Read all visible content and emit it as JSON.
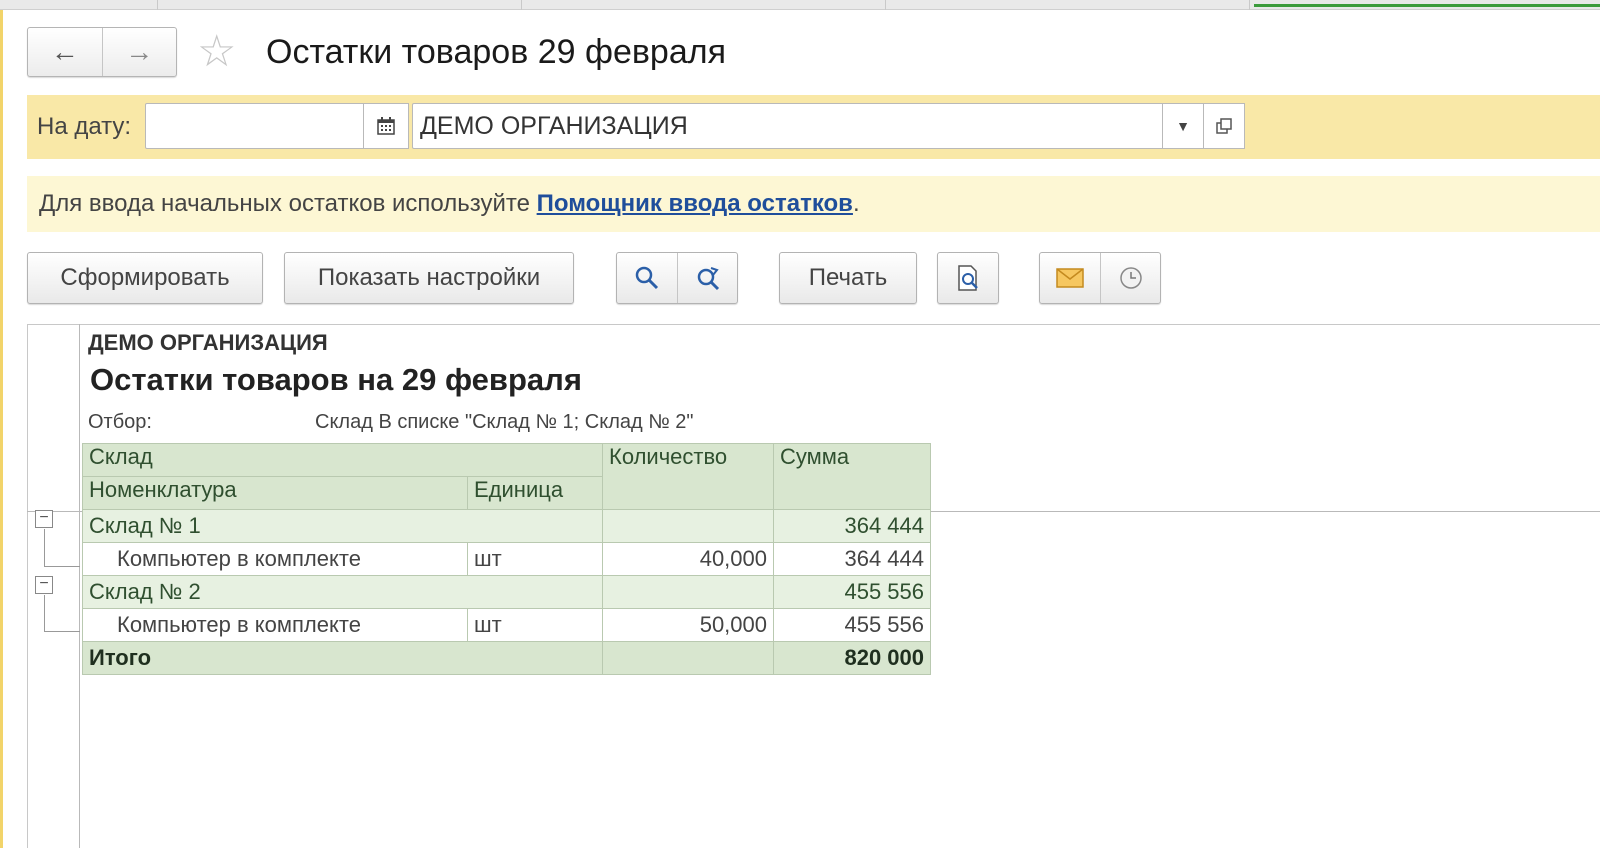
{
  "window": {
    "title": "Остатки товаров 29 февраля"
  },
  "nav": {
    "back_icon": "←",
    "forward_icon": "→",
    "favorite_icon": "☆"
  },
  "filters": {
    "date_label": "На дату:",
    "date_value": "",
    "organization": "ДЕМО ОРГАНИЗАЦИЯ"
  },
  "hint": {
    "text": "Для ввода начальных остатков используйте ",
    "link": "Помощник ввода остатков",
    "suffix": "."
  },
  "toolbar": {
    "generate_label": "Сформировать",
    "settings_label": "Показать настройки",
    "print_label": "Печать"
  },
  "report": {
    "organization": "ДЕМО ОРГАНИЗАЦИЯ",
    "title": "Остатки товаров на 29 февраля",
    "filter_label": "Отбор:",
    "filter_value": "Склад В списке \"Склад № 1; Склад № 2\"",
    "headers": {
      "warehouse": "Склад",
      "item": "Номенклатура",
      "unit": "Единица",
      "quantity": "Количество",
      "sum": "Сумма"
    },
    "groups": [
      {
        "name": "Склад № 1",
        "sum": "364 444",
        "items": [
          {
            "name": "Компьютер в комплекте",
            "unit": "шт",
            "quantity": "40,000",
            "sum": "364 444"
          }
        ]
      },
      {
        "name": "Склад № 2",
        "sum": "455 556",
        "items": [
          {
            "name": "Компьютер в комплекте",
            "unit": "шт",
            "quantity": "50,000",
            "sum": "455 556"
          }
        ]
      }
    ],
    "total_label": "Итого",
    "total_sum": "820 000"
  }
}
